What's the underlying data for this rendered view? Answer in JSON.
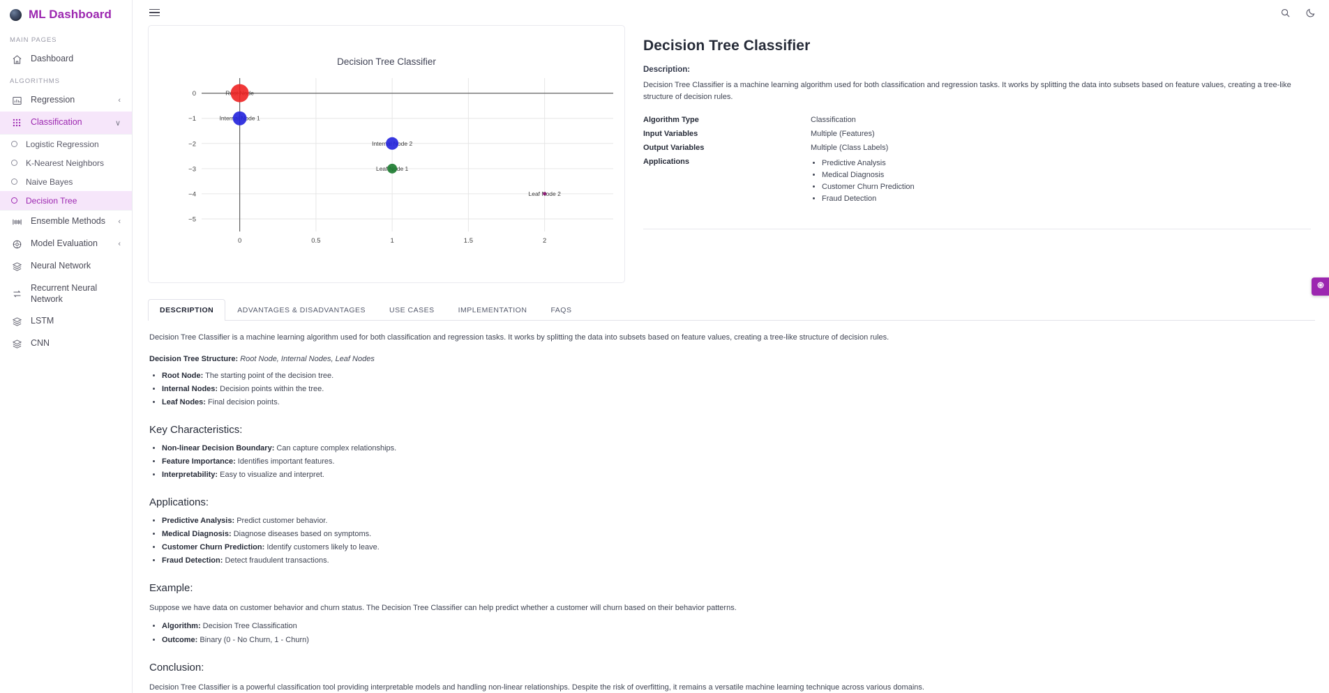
{
  "brand": {
    "title": "ML Dashboard",
    "logo_icon": "globe-icon"
  },
  "sidebar": {
    "sections": [
      {
        "label": "MAIN PAGES",
        "items": [
          {
            "label": "Dashboard",
            "icon": "home-icon",
            "chevron": "",
            "active": false
          }
        ]
      },
      {
        "label": "ALGORITHMS",
        "items": [
          {
            "label": "Regression",
            "icon": "bar-chart-icon",
            "chevron": "‹",
            "active": false
          },
          {
            "label": "Classification",
            "icon": "grid-dots-icon",
            "chevron": "∨",
            "active": true
          }
        ]
      }
    ],
    "submenu": [
      {
        "label": "Logistic Regression",
        "active": false
      },
      {
        "label": "K-Nearest Neighbors",
        "active": false
      },
      {
        "label": "Naive Bayes",
        "active": false
      },
      {
        "label": "Decision Tree",
        "active": true
      }
    ],
    "rest": [
      {
        "label": "Ensemble Methods",
        "icon": "layers-bars-icon",
        "chevron": "‹",
        "active": false
      },
      {
        "label": "Model Evaluation",
        "icon": "target-icon",
        "chevron": "‹",
        "active": false
      },
      {
        "label": "Neural Network",
        "icon": "stack-icon",
        "chevron": "",
        "active": false
      },
      {
        "label": "Recurrent Neural Network",
        "icon": "loop-arrows-icon",
        "chevron": "",
        "active": false
      },
      {
        "label": "LSTM",
        "icon": "stack-icon",
        "chevron": "",
        "active": false
      },
      {
        "label": "CNN",
        "icon": "stack-icon",
        "chevron": "",
        "active": false
      }
    ]
  },
  "topbar": {
    "menu_icon": "hamburger-icon",
    "search_icon": "search-icon",
    "theme_icon": "moon-icon"
  },
  "fab": {
    "icon": "settings-gear-icon",
    "color": "#9c27b0"
  },
  "info": {
    "title": "Decision Tree Classifier",
    "description_label": "Description:",
    "description": "Decision Tree Classifier is a machine learning algorithm used for both classification and regression tasks. It works by splitting the data into subsets based on feature values, creating a tree-like structure of decision rules.",
    "rows": [
      {
        "key": "Algorithm Type",
        "value": "Classification"
      },
      {
        "key": "Input Variables",
        "value": "Multiple (Features)"
      },
      {
        "key": "Output Variables",
        "value": "Multiple (Class Labels)"
      }
    ],
    "applications_key": "Applications",
    "applications": [
      "Predictive Analysis",
      "Medical Diagnosis",
      "Customer Churn Prediction",
      "Fraud Detection"
    ]
  },
  "tabs": [
    {
      "label": "DESCRIPTION",
      "active": true
    },
    {
      "label": "ADVANTAGES & DISADVANTAGES",
      "active": false
    },
    {
      "label": "USE CASES",
      "active": false
    },
    {
      "label": "IMPLEMENTATION",
      "active": false
    },
    {
      "label": "FAQS",
      "active": false
    }
  ],
  "description_tab": {
    "intro": "Decision Tree Classifier is a machine learning algorithm used for both classification and regression tasks. It works by splitting the data into subsets based on feature values, creating a tree-like structure of decision rules.",
    "structure_label": "Decision Tree Structure:",
    "structure_value": "Root Node, Internal Nodes, Leaf Nodes",
    "structure_items": [
      {
        "term": "Root Node:",
        "text": " The starting point of the decision tree."
      },
      {
        "term": "Internal Nodes:",
        "text": " Decision points within the tree."
      },
      {
        "term": "Leaf Nodes:",
        "text": " Final decision points."
      }
    ],
    "key_characteristics_heading": "Key Characteristics:",
    "key_characteristics": [
      {
        "term": "Non-linear Decision Boundary:",
        "text": " Can capture complex relationships."
      },
      {
        "term": "Feature Importance:",
        "text": " Identifies important features."
      },
      {
        "term": "Interpretability:",
        "text": " Easy to visualize and interpret."
      }
    ],
    "applications_heading": "Applications:",
    "applications": [
      {
        "term": "Predictive Analysis:",
        "text": " Predict customer behavior."
      },
      {
        "term": "Medical Diagnosis:",
        "text": " Diagnose diseases based on symptoms."
      },
      {
        "term": "Customer Churn Prediction:",
        "text": " Identify customers likely to leave."
      },
      {
        "term": "Fraud Detection:",
        "text": " Detect fraudulent transactions."
      }
    ],
    "example_heading": "Example:",
    "example_text": "Suppose we have data on customer behavior and churn status. The Decision Tree Classifier can help predict whether a customer will churn based on their behavior patterns.",
    "example_items": [
      {
        "term": "Algorithm:",
        "text": " Decision Tree Classification"
      },
      {
        "term": "Outcome:",
        "text": " Binary (0 - No Churn, 1 - Churn)"
      }
    ],
    "conclusion_heading": "Conclusion:",
    "conclusion_text": "Decision Tree Classifier is a powerful classification tool providing interpretable models and handling non-linear relationships. Despite the risk of overfitting, it remains a versatile machine learning technique across various domains."
  },
  "chart_data": {
    "type": "scatter",
    "title": "Decision Tree Classifier",
    "xlabel": "",
    "ylabel": "",
    "xlim": [
      -0.25,
      2.45
    ],
    "ylim": [
      -5.5,
      0.6
    ],
    "xticks": [
      "0",
      "0.5",
      "1",
      "1.5",
      "2"
    ],
    "xtick_values": [
      0,
      0.5,
      1,
      1.5,
      2
    ],
    "yticks": [
      "0",
      "−1",
      "−2",
      "−3",
      "−4",
      "−5"
    ],
    "ytick_values": [
      0,
      -1,
      -2,
      -3,
      -4,
      -5
    ],
    "grid": true,
    "legend": "none",
    "points": [
      {
        "label": "Root Node",
        "x": 0,
        "y": 0,
        "color": "#ee2222",
        "size": 26,
        "label_pos": "center"
      },
      {
        "label": "Internal Node 1",
        "x": 0,
        "y": -1,
        "color": "#2222dd",
        "size": 20,
        "label_pos": "center"
      },
      {
        "label": "Internal Node 2",
        "x": 1,
        "y": -2,
        "color": "#2222dd",
        "size": 18,
        "label_pos": "center"
      },
      {
        "label": "Leaf Node 1",
        "x": 1,
        "y": -3,
        "color": "#1a7a2e",
        "size": 14,
        "label_pos": "center"
      },
      {
        "label": "Leaf Node 2",
        "x": 2,
        "y": -4,
        "color": "#8a1070",
        "size": 5,
        "label_pos": "center"
      }
    ]
  }
}
